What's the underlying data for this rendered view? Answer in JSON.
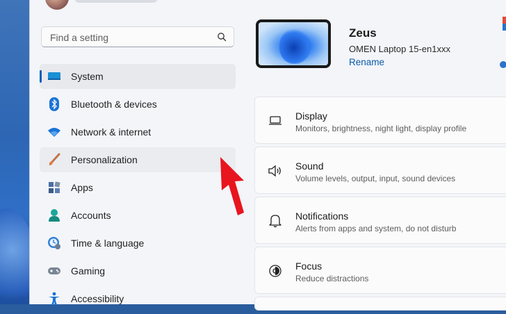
{
  "search": {
    "placeholder": "Find a setting"
  },
  "sidebar": {
    "items": [
      {
        "label": "System",
        "icon": "system-icon",
        "selected": true
      },
      {
        "label": "Bluetooth & devices",
        "icon": "bluetooth-icon"
      },
      {
        "label": "Network & internet",
        "icon": "wifi-icon"
      },
      {
        "label": "Personalization",
        "icon": "brush-icon",
        "hovered": true
      },
      {
        "label": "Apps",
        "icon": "apps-icon"
      },
      {
        "label": "Accounts",
        "icon": "accounts-icon"
      },
      {
        "label": "Time & language",
        "icon": "time-language-icon"
      },
      {
        "label": "Gaming",
        "icon": "gamepad-icon"
      },
      {
        "label": "Accessibility",
        "icon": "accessibility-icon"
      }
    ]
  },
  "device": {
    "name": "Zeus",
    "model": "OMEN Laptop 15-en1xxx",
    "rename_label": "Rename"
  },
  "main": {
    "cards": [
      {
        "title": "Display",
        "subtitle": "Monitors, brightness, night light, display profile",
        "icon": "display-icon"
      },
      {
        "title": "Sound",
        "subtitle": "Volume levels, output, input, sound devices",
        "icon": "speaker-icon"
      },
      {
        "title": "Notifications",
        "subtitle": "Alerts from apps and system, do not disturb",
        "icon": "bell-icon"
      },
      {
        "title": "Focus",
        "subtitle": "Reduce distractions",
        "icon": "focus-icon"
      }
    ]
  },
  "colors": {
    "accent": "#005fb8",
    "annotation_arrow": "#e8141e"
  }
}
